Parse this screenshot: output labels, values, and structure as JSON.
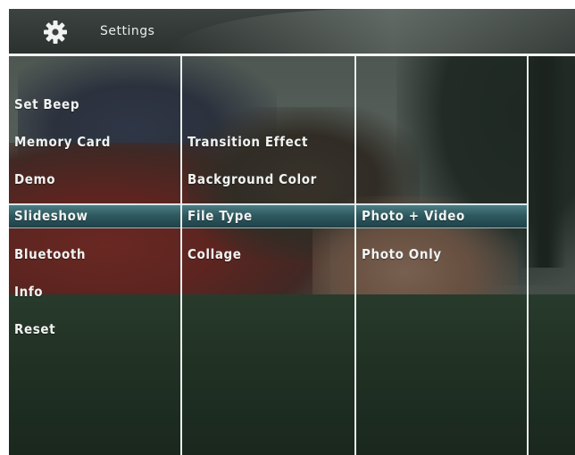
{
  "header": {
    "title": "Settings",
    "icon": "gear-icon"
  },
  "menu": {
    "column1": [
      "Set Beep",
      "Memory Card",
      "Demo",
      "Slideshow",
      "Bluetooth",
      "Info",
      "Reset"
    ],
    "column1_selected": "Slideshow",
    "column2": [
      "Transition Effect",
      "Background Color",
      "File Type",
      "Collage"
    ],
    "column2_selected": "File Type",
    "column3": [
      "Photo + Video",
      "Photo Only"
    ],
    "column3_selected": "Photo + Video"
  },
  "colors": {
    "selection": "#2f5960",
    "divider": "#e9eeec",
    "text": "#f1f4f2"
  }
}
